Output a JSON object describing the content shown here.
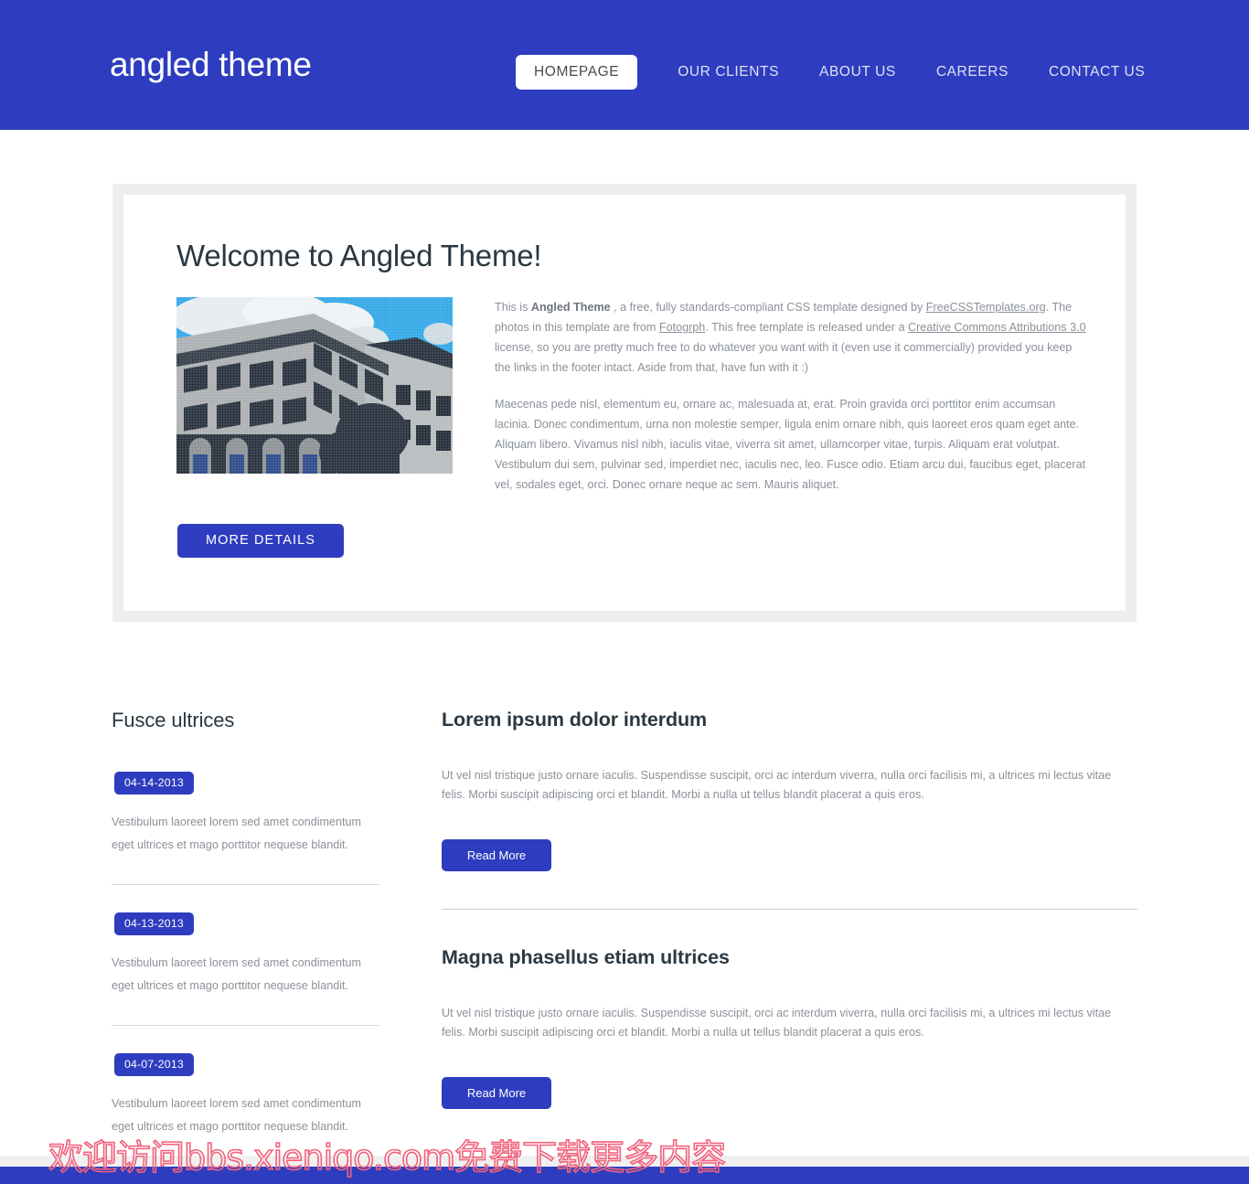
{
  "header": {
    "logo": "angled theme",
    "nav": [
      {
        "label": "HOMEPAGE",
        "active": true
      },
      {
        "label": "OUR CLIENTS",
        "active": false
      },
      {
        "label": "ABOUT US",
        "active": false
      },
      {
        "label": "CAREERS",
        "active": false
      },
      {
        "label": "CONTACT US",
        "active": false
      }
    ]
  },
  "welcome": {
    "title": "Welcome to Angled Theme!",
    "photo_alt": "building-photo",
    "para1": {
      "t1": "This is ",
      "bold": "Angled Theme",
      "t2": " , a free, fully standards-compliant CSS template designed by ",
      "link1": "FreeCSSTemplates.org",
      "t3": ". The photos in this template are from ",
      "link2": "Fotogrph",
      "t4": ". This free template is released under a ",
      "link3": "Creative Commons Attributions 3.0",
      "t5": " license, so you are pretty much free to do whatever you want with it (even use it commercially) provided you keep the links in the footer intact. Aside from that, have fun with it :)"
    },
    "para2": "Maecenas pede nisl, elementum eu, ornare ac, malesuada at, erat. Proin gravida orci porttitor enim accumsan lacinia. Donec condimentum, urna non molestie semper, ligula enim ornare nibh, quis laoreet eros quam eget ante. Aliquam libero. Vivamus nisl nibh, iaculis vitae, viverra sit amet, ullamcorper vitae, turpis. Aliquam erat volutpat. Vestibulum dui sem, pulvinar sed, imperdiet nec, iaculis nec, leo. Fusce odio. Etiam arcu dui, faucibus eget, placerat vel, sodales eget, orci. Donec ornare neque ac sem. Mauris aliquet.",
    "button": "MORE DETAILS"
  },
  "sidebar": {
    "title": "Fusce ultrices",
    "items": [
      {
        "date": "04-14-2013",
        "text": "Vestibulum laoreet lorem sed amet condimentum eget ultrices et mago porttitor nequese blandit."
      },
      {
        "date": "04-13-2013",
        "text": "Vestibulum laoreet lorem sed amet condimentum eget ultrices et mago porttitor nequese blandit."
      },
      {
        "date": "04-07-2013",
        "text": "Vestibulum laoreet lorem sed amet condimentum eget ultrices et mago porttitor nequese blandit."
      }
    ]
  },
  "articles": [
    {
      "title": "Lorem ipsum dolor interdum",
      "text": "Ut vel nisl tristique justo ornare iaculis. Suspendisse suscipit, orci ac interdum viverra, nulla orci facilisis mi, a ultrices mi lectus vitae felis. Morbi suscipit adipiscing orci et blandit. Morbi a nulla ut tellus blandit placerat a quis eros.",
      "button": "Read More"
    },
    {
      "title": "Magna phasellus etiam ultrices",
      "text": "Ut vel nisl tristique justo ornare iaculis. Suspendisse suscipit, orci ac interdum viverra, nulla orci facilisis mi, a ultrices mi lectus vitae felis. Morbi suscipit adipiscing orci et blandit. Morbi a nulla ut tellus blandit placerat a quis eros.",
      "button": "Read More"
    }
  ],
  "watermark": {
    "text": "欢迎访问bbs.xieniqo.com免费下载更多内容"
  },
  "colors": {
    "brand_blue": "#2e3dbf",
    "heading_dark": "#2b3841",
    "body_gray": "#8b9199",
    "panel_frame": "#eceef0",
    "divider": "#ccd1d6"
  }
}
